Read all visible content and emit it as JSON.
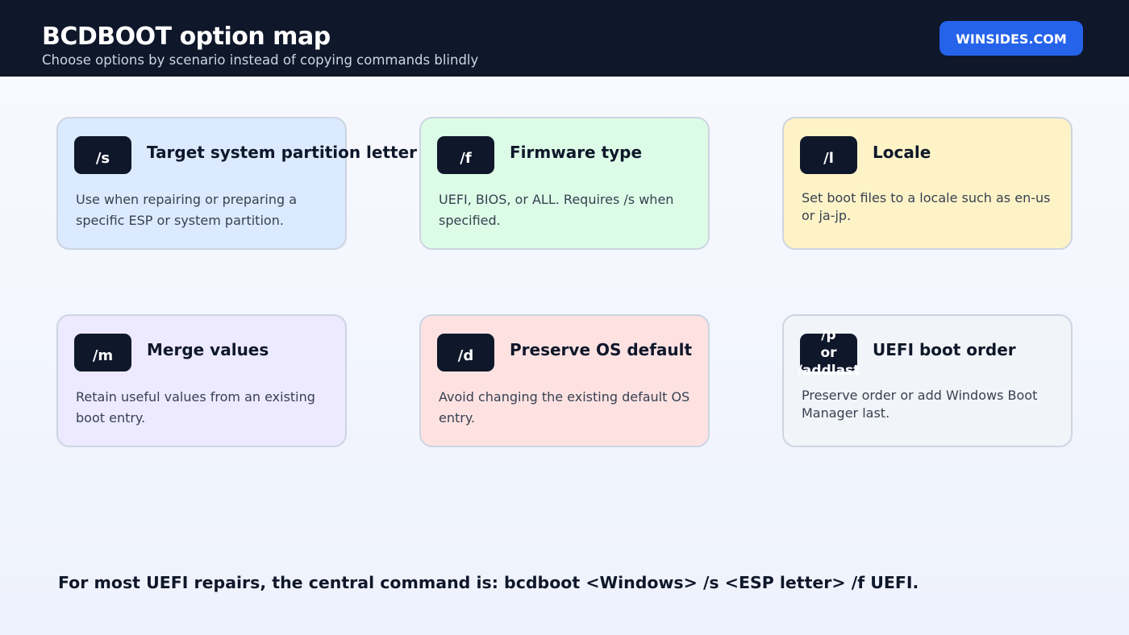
{
  "header": {
    "title": "BCDBOOT option map",
    "subtitle": "Choose options by scenario instead of copying commands blindly",
    "brand": "WINSIDES.COM"
  },
  "cards": [
    {
      "option": "/s",
      "title": "Target system partition letter",
      "description": "Use when repairing or preparing a specific ESP or system partition.",
      "bg": "#dbeafe"
    },
    {
      "option": "/f",
      "title": "Firmware type",
      "description": "UEFI, BIOS, or ALL. Requires /s when specified.",
      "bg": "#dcfce7"
    },
    {
      "option": "/l",
      "title": "Locale",
      "description": "Set boot files to a locale such as en-us or ja-jp.",
      "bg": "#fef3c7"
    },
    {
      "option": "/m",
      "title": "Merge values",
      "description": "Retain useful values from an existing boot entry.",
      "bg": "#ede9fe"
    },
    {
      "option": "/d",
      "title": "Preserve OS default",
      "description": "Avoid changing the existing default OS entry.",
      "bg": "#fee2e2"
    },
    {
      "option": "/p or /addlast",
      "title": "UEFI boot order",
      "description": "Preserve order or add Windows Boot Manager last.",
      "bg": "#f1f5f9"
    }
  ],
  "footer": "For most UEFI repairs, the central command is: bcdboot <Windows> /s <ESP letter> /f UEFI.",
  "colors": {
    "header_bg": "#0f172a",
    "brand_bg": "#2563eb",
    "badge_bg": "#0f172a"
  }
}
